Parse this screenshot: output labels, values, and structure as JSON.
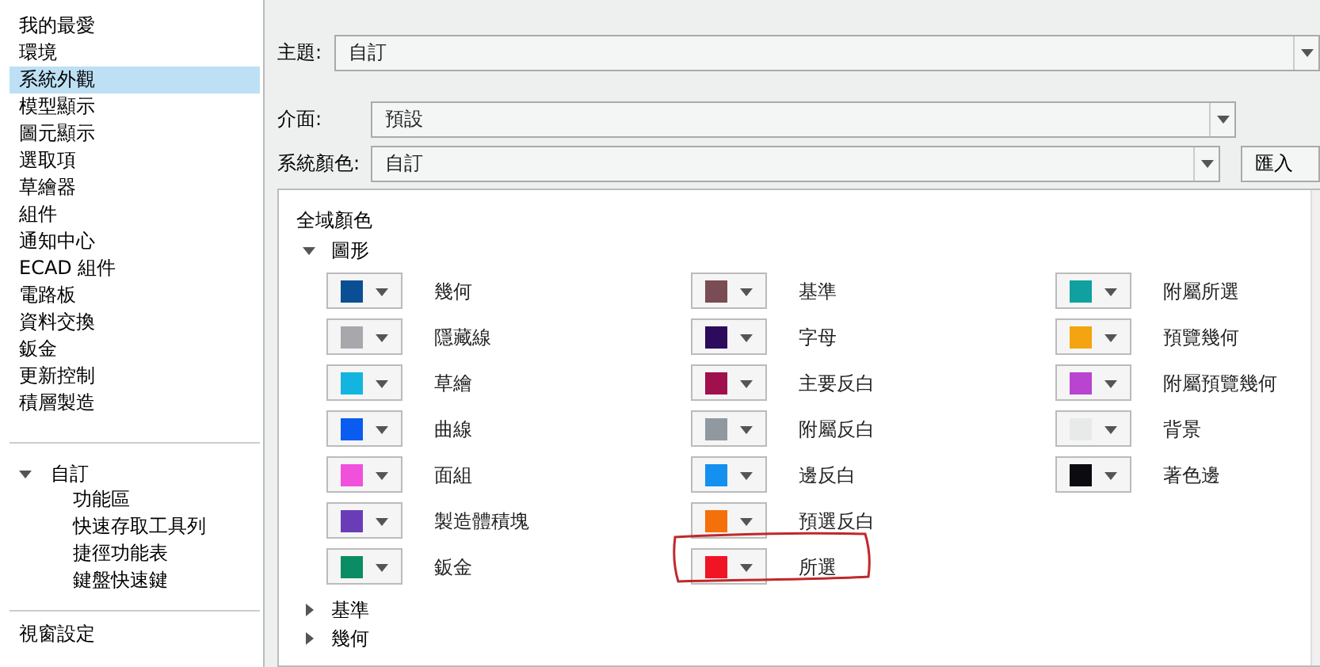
{
  "sidebar": {
    "items": [
      {
        "label": "我的最愛",
        "selected": false
      },
      {
        "label": "環境",
        "selected": false
      },
      {
        "label": "系統外觀",
        "selected": true
      },
      {
        "label": "模型顯示",
        "selected": false
      },
      {
        "label": "圖元顯示",
        "selected": false
      },
      {
        "label": "選取項",
        "selected": false
      },
      {
        "label": "草繪器",
        "selected": false
      },
      {
        "label": "組件",
        "selected": false
      },
      {
        "label": "通知中心",
        "selected": false
      },
      {
        "label": "ECAD 組件",
        "selected": false
      },
      {
        "label": "電路板",
        "selected": false
      },
      {
        "label": "資料交換",
        "selected": false
      },
      {
        "label": "鈑金",
        "selected": false
      },
      {
        "label": "更新控制",
        "selected": false
      },
      {
        "label": "積層製造",
        "selected": false
      }
    ],
    "custom": {
      "label": "自訂",
      "expanded": true,
      "children": [
        {
          "label": "功能區"
        },
        {
          "label": "快速存取工具列"
        },
        {
          "label": "捷徑功能表"
        },
        {
          "label": "鍵盤快速鍵"
        }
      ]
    },
    "footer_item": "視窗設定"
  },
  "theme": {
    "label": "主題:",
    "value": "自訂"
  },
  "interface": {
    "label": "介面:",
    "value": "預設"
  },
  "system_colors": {
    "label": "系統顏色:",
    "value": "自訂",
    "import_button": "匯入"
  },
  "panel": {
    "title": "全域顏色",
    "sections": [
      {
        "label": "圖形",
        "expanded": true,
        "columns": [
          [
            {
              "label": "幾何",
              "color": "#0a4f94",
              "highlighted": false
            },
            {
              "label": "隱藏線",
              "color": "#a8a8ac",
              "highlighted": false
            },
            {
              "label": "草繪",
              "color": "#14b4e0",
              "highlighted": false
            },
            {
              "label": "曲線",
              "color": "#0a5cf0",
              "highlighted": false
            },
            {
              "label": "面組",
              "color": "#f050dc",
              "highlighted": false
            },
            {
              "label": "製造體積塊",
              "color": "#6a3cb8",
              "highlighted": false
            },
            {
              "label": "鈑金",
              "color": "#0a8c64",
              "highlighted": false
            }
          ],
          [
            {
              "label": "基準",
              "color": "#7a4c54",
              "highlighted": false
            },
            {
              "label": "字母",
              "color": "#2c0a5c",
              "highlighted": false
            },
            {
              "label": "主要反白",
              "color": "#a0104c",
              "highlighted": false
            },
            {
              "label": "附屬反白",
              "color": "#9098a0",
              "highlighted": false
            },
            {
              "label": "邊反白",
              "color": "#1490f0",
              "highlighted": false
            },
            {
              "label": "預選反白",
              "color": "#f4700a",
              "highlighted": false
            },
            {
              "label": "所選",
              "color": "#f01424",
              "highlighted": true
            }
          ],
          [
            {
              "label": "附屬所選",
              "color": "#10a0a0",
              "highlighted": false
            },
            {
              "label": "預覽幾何",
              "color": "#f4a410",
              "highlighted": false
            },
            {
              "label": "附屬預覽幾何",
              "color": "#b844d0",
              "highlighted": false
            },
            {
              "label": "背景",
              "color": "#e8eaea",
              "highlighted": false
            },
            {
              "label": "著色邊",
              "color": "#0c0c10",
              "highlighted": false
            }
          ]
        ]
      },
      {
        "label": "基準",
        "expanded": false
      },
      {
        "label": "幾何",
        "expanded": false
      }
    ]
  }
}
